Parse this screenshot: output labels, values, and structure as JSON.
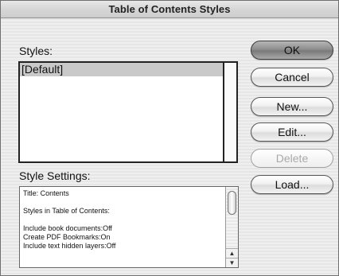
{
  "window": {
    "title": "Table of Contents Styles"
  },
  "styles": {
    "label": "Styles:",
    "items": [
      {
        "label": "[Default]",
        "selected": true
      }
    ]
  },
  "settings": {
    "label": "Style Settings:",
    "lines": [
      "Title: Contents",
      "",
      "Styles in Table of Contents:",
      "",
      "Include book documents:Off",
      "Create PDF Bookmarks:On",
      "Include text hidden layers:Off"
    ]
  },
  "buttons": {
    "ok": "OK",
    "cancel": "Cancel",
    "new": "New...",
    "edit": "Edit...",
    "delete": "Delete",
    "load": "Load..."
  },
  "icons": {
    "scroll_up": "▲",
    "scroll_down": "▼"
  },
  "colors": {
    "default_button": "#8e8e8e",
    "selection": "#c9c9c9"
  }
}
